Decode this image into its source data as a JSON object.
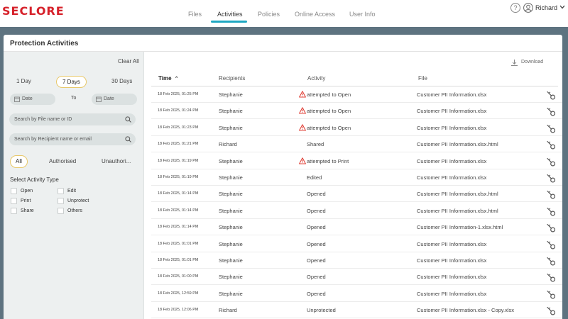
{
  "brand": {
    "logo_text": "SECLORE",
    "color": "#d6212a"
  },
  "nav": {
    "tabs": [
      {
        "label": "Files",
        "active": false
      },
      {
        "label": "Activities",
        "active": true
      },
      {
        "label": "Policies",
        "active": false
      },
      {
        "label": "Online Access",
        "active": false
      },
      {
        "label": "User Info",
        "active": false
      }
    ],
    "accent": "#1fa7c2"
  },
  "header": {
    "help_glyph": "?",
    "help_icon": "question-circle-icon",
    "user_icon": "user-circle-icon",
    "user_name": "Richard"
  },
  "panel": {
    "title": "Protection Activities"
  },
  "filters": {
    "clear_all": "Clear All",
    "ranges": [
      {
        "label": "1 Day",
        "active": false
      },
      {
        "label": "7 Days",
        "active": true
      },
      {
        "label": "30 Days",
        "active": false
      }
    ],
    "date_from_placeholder": "Date",
    "to_label": "To",
    "date_to_placeholder": "Date",
    "search_file_placeholder": "Search by File name or ID",
    "search_recipient_placeholder": "Search by Recipient name or email",
    "segments": [
      {
        "label": "All",
        "active": true
      },
      {
        "label": "Authorised",
        "active": false
      },
      {
        "label": "Unauthori...",
        "active": false
      }
    ],
    "activity_type_title": "Select Activity Type",
    "activity_types": [
      "Open",
      "Edit",
      "Print",
      "Unprotect",
      "Share",
      "Others"
    ]
  },
  "table": {
    "download_label": "Download",
    "columns": {
      "time": "Time",
      "sort_glyph": "⌃",
      "recipients": "Recipients",
      "activity": "Activity",
      "file": "File"
    },
    "rows": [
      {
        "time": "18 Feb 2025, 01:25 PM",
        "recipient": "Stephanie",
        "activity": "attempted to Open",
        "warning": true,
        "file": "Customer PII Information.xlsx"
      },
      {
        "time": "18 Feb 2025, 01:24 PM",
        "recipient": "Stephanie",
        "activity": "attempted to Open",
        "warning": true,
        "file": "Customer PII Information.xlsx"
      },
      {
        "time": "18 Feb 2025, 01:23 PM",
        "recipient": "Stephanie",
        "activity": "attempted to Open",
        "warning": true,
        "file": "Customer PII Information.xlsx"
      },
      {
        "time": "18 Feb 2025, 01:21 PM",
        "recipient": "Richard",
        "activity": "Shared",
        "warning": false,
        "file": "Customer PII Information.xlsx.html"
      },
      {
        "time": "18 Feb 2025, 01:19 PM",
        "recipient": "Stephanie",
        "activity": "attempted to Print",
        "warning": true,
        "file": "Customer PII Information.xlsx"
      },
      {
        "time": "18 Feb 2025, 01:19 PM",
        "recipient": "Stephanie",
        "activity": "Edited",
        "warning": false,
        "file": "Customer PII Information.xlsx"
      },
      {
        "time": "18 Feb 2025, 01:14 PM",
        "recipient": "Stephanie",
        "activity": "Opened",
        "warning": false,
        "file": "Customer PII Information.xlsx.html"
      },
      {
        "time": "18 Feb 2025, 01:14 PM",
        "recipient": "Stephanie",
        "activity": "Opened",
        "warning": false,
        "file": "Customer PII Information.xlsx.html"
      },
      {
        "time": "18 Feb 2025, 01:14 PM",
        "recipient": "Stephanie",
        "activity": "Opened",
        "warning": false,
        "file": "Customer PII Information-1.xlsx.html"
      },
      {
        "time": "18 Feb 2025, 01:01 PM",
        "recipient": "Stephanie",
        "activity": "Opened",
        "warning": false,
        "file": "Customer PII Information.xlsx"
      },
      {
        "time": "18 Feb 2025, 01:01 PM",
        "recipient": "Stephanie",
        "activity": "Opened",
        "warning": false,
        "file": "Customer PII Information.xlsx"
      },
      {
        "time": "18 Feb 2025, 01:00 PM",
        "recipient": "Stephanie",
        "activity": "Opened",
        "warning": false,
        "file": "Customer PII Information.xlsx"
      },
      {
        "time": "18 Feb 2025, 12:59 PM",
        "recipient": "Stephanie",
        "activity": "Opened",
        "warning": false,
        "file": "Customer PII Information.xlsx"
      },
      {
        "time": "18 Feb 2025, 12:06 PM",
        "recipient": "Richard",
        "activity": "Unprotected",
        "warning": false,
        "file": "Customer PII Information.xlsx - Copy.xlsx"
      }
    ],
    "row_action_icon": "key-icon",
    "warning_color": "#e0433a"
  }
}
